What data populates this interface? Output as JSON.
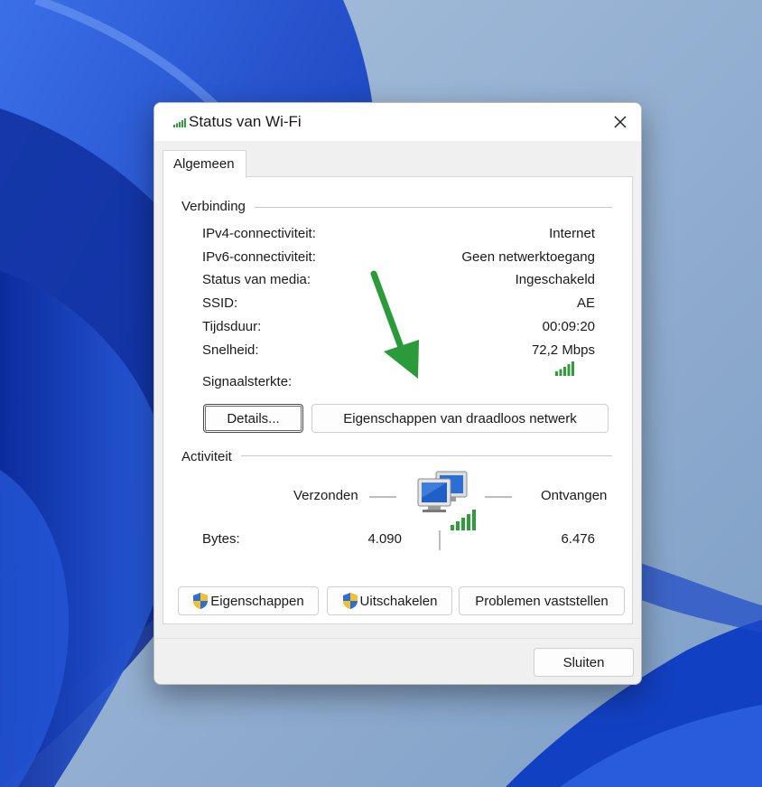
{
  "window": {
    "title": "Status van Wi-Fi",
    "close_glyph": "✕"
  },
  "tabs": [
    {
      "label": "Algemeen",
      "active": true
    }
  ],
  "connection": {
    "title": "Verbinding",
    "rows": [
      {
        "label": "IPv4-connectiviteit:",
        "value": "Internet"
      },
      {
        "label": "IPv6-connectiviteit:",
        "value": "Geen netwerktoegang"
      },
      {
        "label": "Status van media:",
        "value": "Ingeschakeld"
      },
      {
        "label": "SSID:",
        "value": "AE"
      },
      {
        "label": "Tijdsduur:",
        "value": "00:09:20"
      },
      {
        "label": "Snelheid:",
        "value": "72,2 Mbps"
      }
    ],
    "signal_label": "Signaalsterkte:",
    "signal_bars_lit": 5,
    "signal_bars_total": 5,
    "details_button": "Details...",
    "wireless_properties_button": "Eigenschappen van draadloos netwerk"
  },
  "activity": {
    "title": "Activiteit",
    "sent_label": "Verzonden",
    "received_label": "Ontvangen",
    "bytes_label": "Bytes:",
    "bytes_sent": "4.090",
    "bytes_received": "6.476"
  },
  "buttons": {
    "properties": "Eigenschappen",
    "disable": "Uitschakelen",
    "diagnose": "Problemen vaststellen",
    "close": "Sluiten"
  },
  "colors": {
    "signal_green": "#2f9e3a",
    "annotation_arrow": "#2a9a3a",
    "shield_blue": "#2f6fd0",
    "shield_yellow": "#f2c12e"
  },
  "icons": {
    "title": "wifi-signal-icon",
    "network": "network-computers-icon",
    "shield": "uac-shield-icon",
    "annotation": "green-arrow-annotation"
  }
}
